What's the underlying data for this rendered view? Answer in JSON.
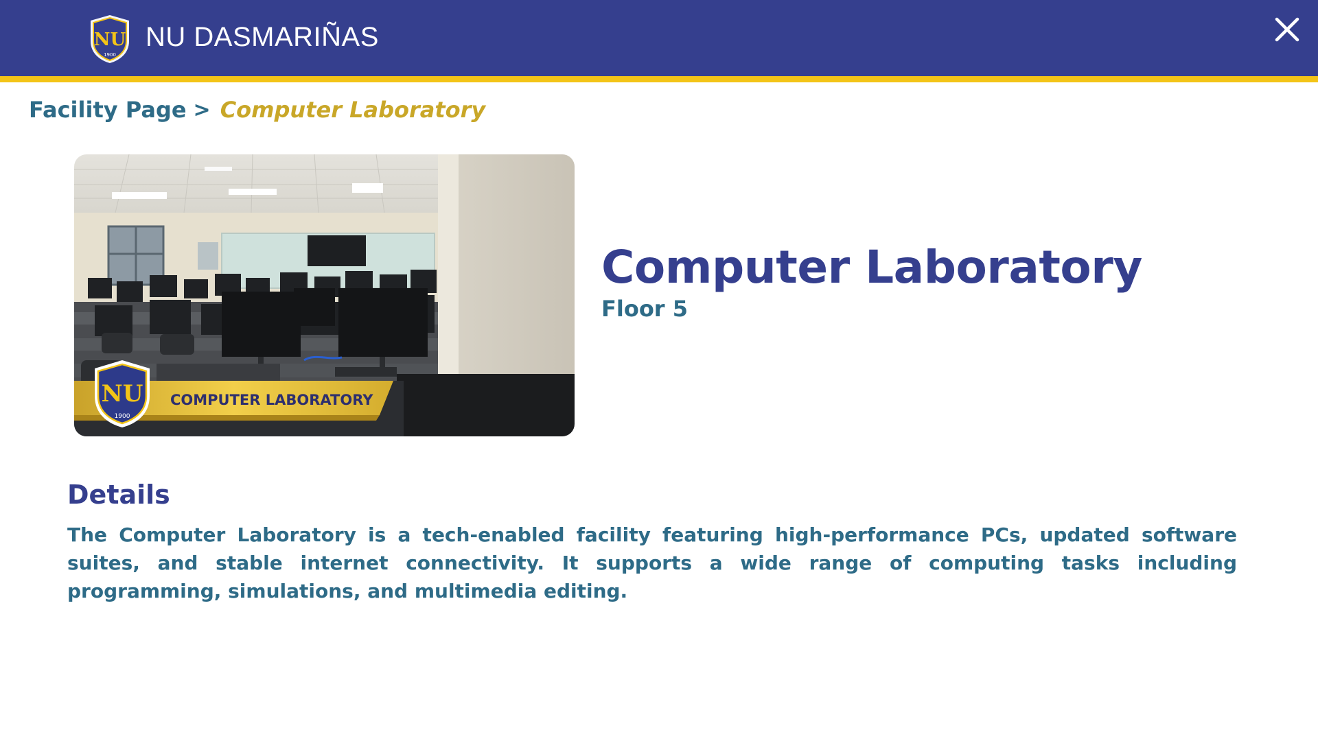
{
  "header": {
    "brand_title": "NU DASMARIÑAS",
    "logo_text": "NU",
    "logo_year": "1900",
    "background_color": "#353f8e",
    "stripe_color": "#f3c417"
  },
  "breadcrumb": {
    "parent_label": "Facility Page",
    "separator": ">",
    "current_label": "Computer Laboratory"
  },
  "facility": {
    "title": "Computer Laboratory",
    "floor": "Floor 5",
    "photo_banner_text": "COMPUTER LABORATORY",
    "photo_logo_year": "1900"
  },
  "details": {
    "heading": "Details",
    "body": "The Computer Laboratory is a tech-enabled facility featuring high-performance PCs, updated software suites, and stable internet connectivity. It supports a wide range of computing tasks including programming, simulations, and multimedia editing."
  },
  "icons": {
    "close": "close-icon",
    "logo": "nu-shield-logo-icon"
  },
  "colors": {
    "primary_navy": "#353f8e",
    "accent_gold": "#c9a728",
    "teal_text": "#2e6b87"
  }
}
